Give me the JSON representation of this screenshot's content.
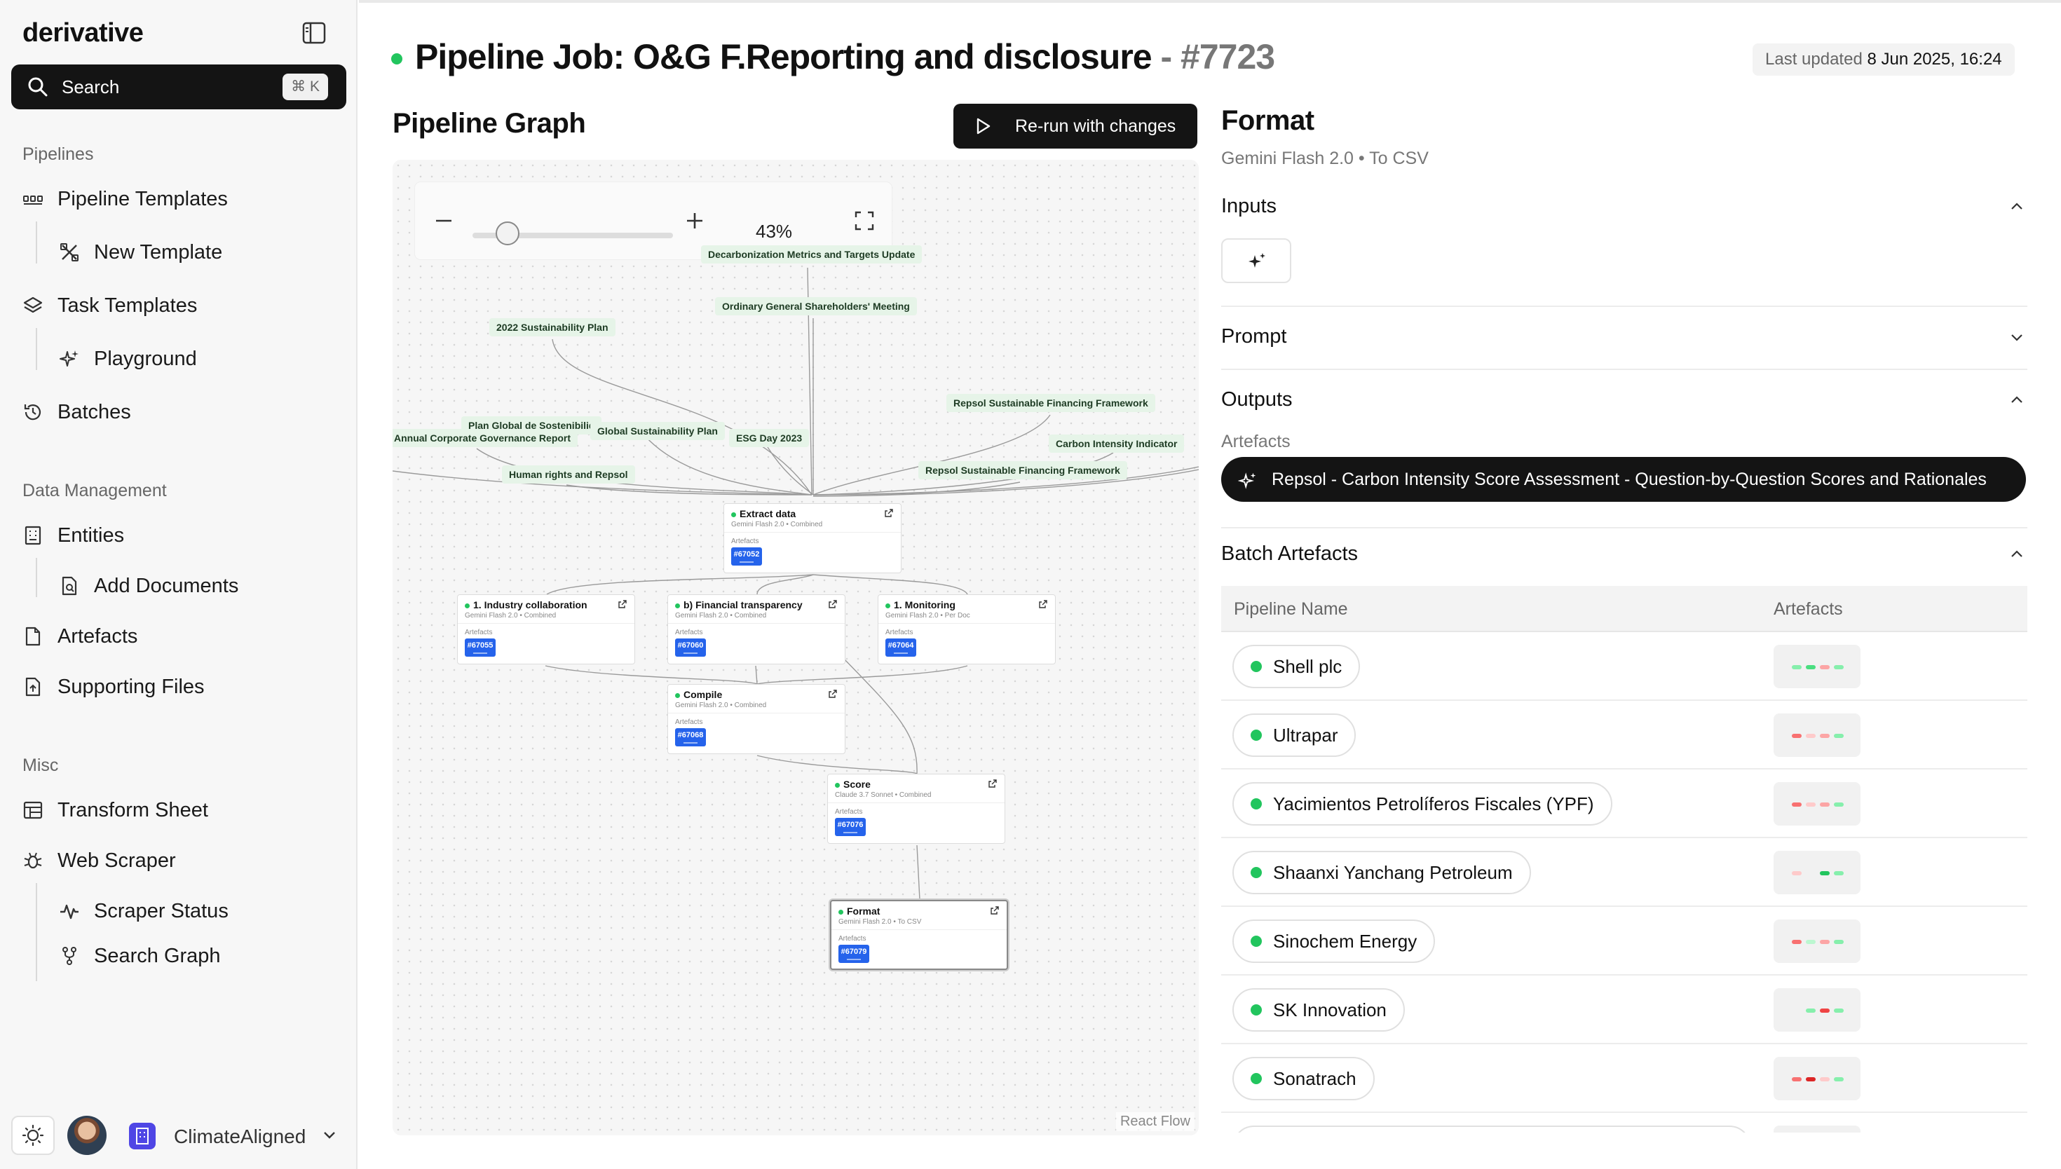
{
  "sidebar": {
    "brand": "derivative",
    "search": {
      "label": "Search",
      "shortcut": "⌘ K"
    },
    "sections": {
      "pipelines": "Pipelines",
      "data_management": "Data Management",
      "misc": "Misc"
    },
    "items": {
      "pipeline_templates": "Pipeline Templates",
      "new_template": "New Template",
      "task_templates": "Task Templates",
      "playground": "Playground",
      "batches": "Batches",
      "entities": "Entities",
      "add_documents": "Add Documents",
      "artefacts": "Artefacts",
      "supporting_files": "Supporting Files",
      "transform_sheet": "Transform Sheet",
      "web_scraper": "Web Scraper",
      "scraper_status": "Scraper Status",
      "search_graph": "Search Graph"
    },
    "org_name": "ClimateAligned"
  },
  "header": {
    "title": "Pipeline Job: O&G F.Reporting and disclosure",
    "job_id": " - #7723",
    "last_updated_label": "Last updated",
    "last_updated_value": "8 Jun 2025, 16:24",
    "status_color": "#22c55e"
  },
  "graph": {
    "title": "Pipeline Graph",
    "rerun_label": "Re-run with changes",
    "zoom": "43%",
    "zoom_fraction": 0.43,
    "attribution": "React Flow",
    "doc_labels": [
      "Decarbonization Metrics and Targets Update",
      "Ordinary General Shareholders' Meeting",
      "2022 Sustainability Plan",
      "Repsol Sustainable Financing Framework",
      "Plan Global de Sostenibilid",
      "Global Sustainability Plan",
      "Annual Corporate Governance Report",
      "ESG Day 2023",
      "Carbon Intensity Indicator",
      "Human rights and Repsol",
      "Repsol Sustainable Financing Framework"
    ],
    "artefacts_label": "Artefacts",
    "nodes": [
      {
        "title": "Extract data",
        "sub": "Gemini Flash 2.0 • Combined",
        "chip": "#67052"
      },
      {
        "title": "1. Industry collaboration",
        "sub": "Gemini Flash 2.0 • Combined",
        "chip": "#67055"
      },
      {
        "title": "b) Financial transparency",
        "sub": "Gemini Flash 2.0 • Combined",
        "chip": "#67060"
      },
      {
        "title": "1. Monitoring",
        "sub": "Gemini Flash 2.0 • Per Doc",
        "chip": "#67064"
      },
      {
        "title": "Compile",
        "sub": "Gemini Flash 2.0 • Combined",
        "chip": "#67068"
      },
      {
        "title": "Score",
        "sub": "Claude 3.7 Sonnet • Combined",
        "chip": "#67076"
      },
      {
        "title": "Format",
        "sub": "Gemini Flash 2.0 • To CSV",
        "chip": "#67079"
      }
    ]
  },
  "panel": {
    "title": "Format",
    "subtitle": "Gemini Flash 2.0 • To CSV",
    "inputs": "Inputs",
    "prompt": "Prompt",
    "outputs": "Outputs",
    "artefacts_label": "Artefacts",
    "artefact_name": "Repsol - Carbon Intensity Score Assessment - Question-by-Question Scores and Rationales",
    "batch_artefacts": "Batch Artefacts",
    "table": {
      "col_pipeline": "Pipeline Name",
      "col_artefacts": "Artefacts",
      "rows": [
        {
          "name": "Shell plc",
          "bars": [
            "#86efac",
            "#4ade80",
            "#fca5a5",
            "#86efac"
          ]
        },
        {
          "name": "Ultrapar",
          "bars": [
            "#f87171",
            "#fecaca",
            "#fca5a5",
            "#86efac"
          ]
        },
        {
          "name": "Yacimientos Petrolíferos Fiscales (YPF)",
          "bars": [
            "#f87171",
            "#fecaca",
            "#fca5a5",
            "#86efac"
          ]
        },
        {
          "name": "Shaanxi Yanchang Petroleum",
          "bars": [
            "#fecaca",
            "#f1f1f1",
            "#22c55e",
            "#86efac"
          ]
        },
        {
          "name": "Sinochem Energy",
          "bars": [
            "#f87171",
            "#bbf7d0",
            "#fca5a5",
            "#86efac"
          ]
        },
        {
          "name": "SK Innovation",
          "bars": [
            "#f1f1f1",
            "#86efac",
            "#ef4444",
            "#86efac"
          ]
        },
        {
          "name": "Sonatrach",
          "bars": [
            "#f87171",
            "#dc2626",
            "#fecaca",
            "#86efac"
          ]
        }
      ]
    }
  }
}
